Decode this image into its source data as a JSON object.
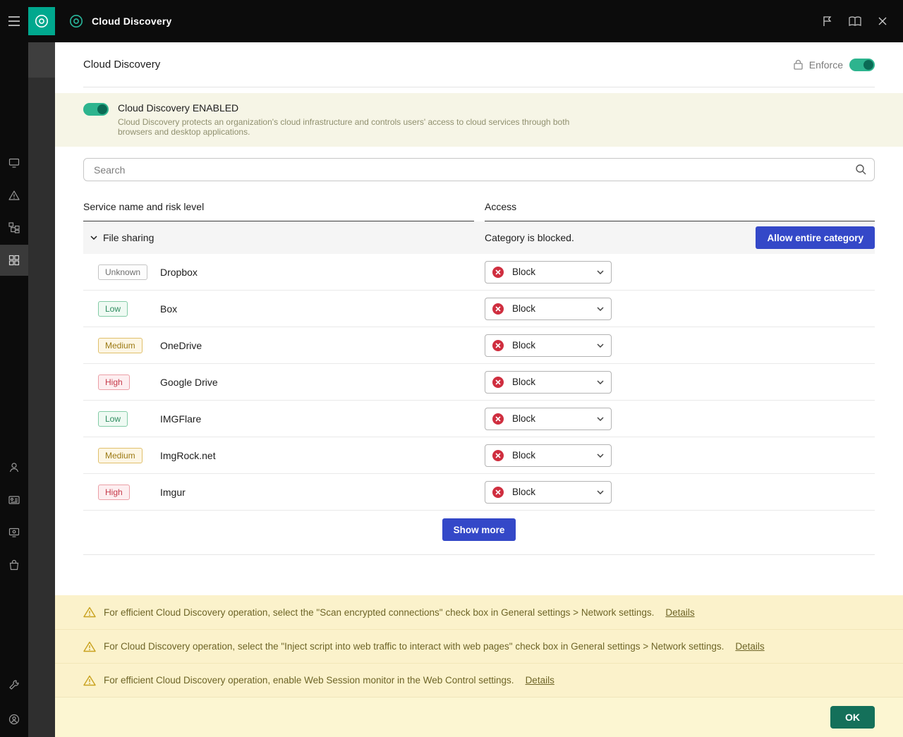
{
  "topbar": {
    "title": "Cloud Discovery",
    "icons": [
      "flag-icon",
      "manual-icon",
      "close-icon"
    ]
  },
  "sidebar": {
    "icons": [
      "menu-icon",
      "dashboard-icon",
      "alerts-icon",
      "hierarchy-icon",
      "apps-grid-icon",
      "users-icon",
      "id-card-icon",
      "workstation-icon",
      "marketplace-icon",
      "tools-icon",
      "profile-icon"
    ],
    "selected": "apps-grid-icon"
  },
  "page": {
    "title": "Cloud Discovery",
    "enforce_label": "Enforce",
    "enforce_on": true
  },
  "enable_banner": {
    "title": "Cloud Discovery ENABLED",
    "description": "Cloud Discovery protects an organization's cloud infrastructure and controls users' access to cloud services through both browsers and desktop applications.",
    "enabled": true
  },
  "search": {
    "placeholder": "Search"
  },
  "table": {
    "columns": [
      "Service name and risk level",
      "Access"
    ],
    "category": {
      "label": "File sharing",
      "status": "Category is blocked.",
      "action": "Allow entire category",
      "expanded": true
    },
    "rows": [
      {
        "risk_label": "Unknown",
        "risk_level": "unknown",
        "name": "Dropbox",
        "access": "Block"
      },
      {
        "risk_label": "Low",
        "risk_level": "low",
        "name": "Box",
        "access": "Block"
      },
      {
        "risk_label": "Medium",
        "risk_level": "medium",
        "name": "OneDrive",
        "access": "Block"
      },
      {
        "risk_label": "High",
        "risk_level": "high",
        "name": "Google Drive",
        "access": "Block"
      },
      {
        "risk_label": "Low",
        "risk_level": "low",
        "name": "IMGFlare",
        "access": "Block"
      },
      {
        "risk_label": "Medium",
        "risk_level": "medium",
        "name": "ImgRock.net",
        "access": "Block"
      },
      {
        "risk_label": "High",
        "risk_level": "high",
        "name": "Imgur",
        "access": "Block"
      }
    ],
    "show_more": "Show more"
  },
  "warnings": [
    {
      "text": "For efficient Cloud Discovery operation, select the \"Scan encrypted connections\" check box in General settings > Network settings.",
      "link": "Details"
    },
    {
      "text": "For Cloud Discovery operation, select the \"Inject script into web traffic to interact with web pages\" check box in General settings > Network settings.",
      "link": "Details"
    },
    {
      "text": "For efficient Cloud Discovery operation, enable Web Session monitor in the Web Control settings.",
      "link": "Details"
    }
  ],
  "footer": {
    "ok": "OK"
  },
  "colors": {
    "accent_blue": "#3448c8",
    "accent_teal": "#00a88e",
    "toggle_green": "#2db48e",
    "ok_green": "#14705a",
    "warning_bg": "#fbf2cb",
    "footer_bg": "#fcf6d2",
    "risk_low": "#2e8b5f",
    "risk_medium": "#9c7a14",
    "risk_high": "#c63a4a",
    "block_red": "#cf2e3f"
  }
}
